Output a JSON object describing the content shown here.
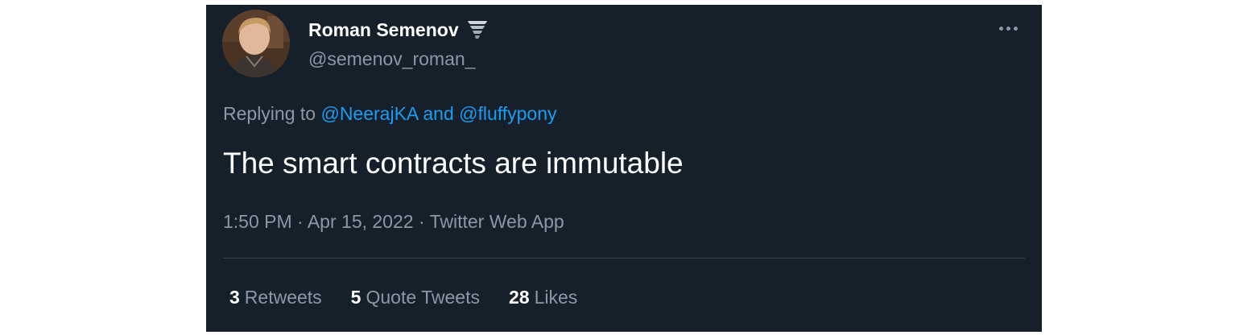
{
  "tweet": {
    "author": {
      "display_name": "Roman Semenov",
      "handle": "@semenov_roman_",
      "badge_icon": "tornado-icon"
    },
    "more_icon": "more-icon",
    "replying_to": {
      "prefix": "Replying to",
      "mention_1": "@NeerajKA",
      "conjunction": "and",
      "mention_2": "@fluffypony"
    },
    "text": "The smart contracts are immutable",
    "meta": {
      "time": "1:50 PM",
      "date": "Apr 15, 2022",
      "source": "Twitter Web App",
      "separator": "·"
    },
    "stats": {
      "retweets_count": "3",
      "retweets_label": "Retweets",
      "quotes_count": "5",
      "quotes_label": "Quote Tweets",
      "likes_count": "28",
      "likes_label": "Likes"
    }
  },
  "colors": {
    "background": "#15202b",
    "primary_text": "#ffffff",
    "secondary_text": "#8b98a5",
    "link": "#1d9bf0",
    "divider": "#38444d"
  }
}
